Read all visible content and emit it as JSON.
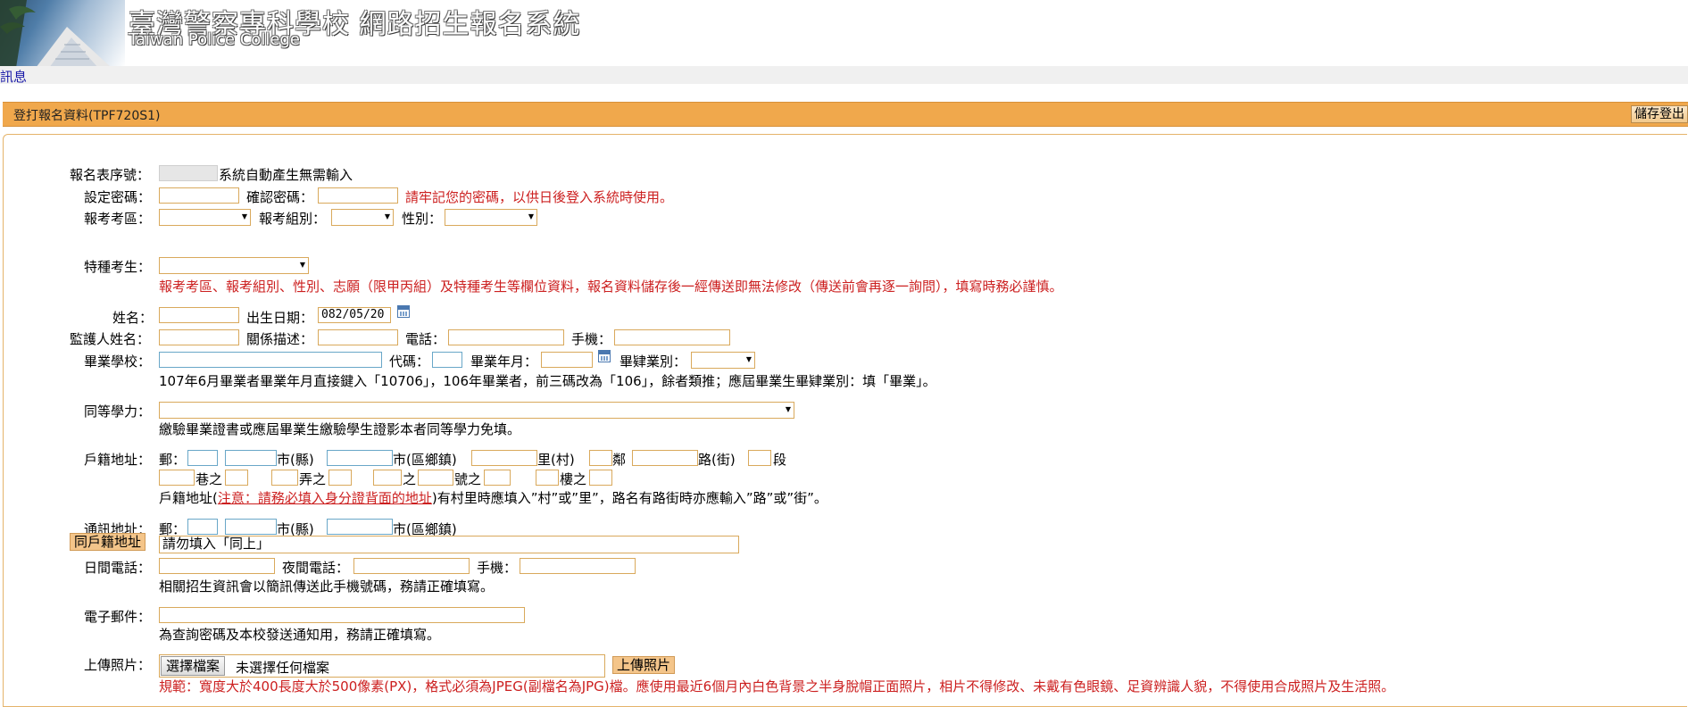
{
  "header": {
    "title": "臺灣警察專科學校  網路招生報名系統",
    "subtitle": "Taiwan Police College"
  },
  "messages_link": "訊息",
  "section": {
    "title": "登打報名資料(TPF720S1)",
    "save_logout": "儲存登出"
  },
  "form": {
    "serial_label": "報名表序號：",
    "serial_note": "系統自動產生無需輸入",
    "pwd_label": "設定密碼：",
    "pwd_confirm_label": "確認密碼：",
    "pwd_note": "請牢記您的密碼，以供日後登入系統時使用。",
    "region_label": "報考考區：",
    "group_label": "報考組別：",
    "gender_label": "性別：",
    "special_label": "特種考生：",
    "special_note": "報考考區、報考組別、性別、志願（限甲丙組）及特種考生等欄位資料，報名資料儲存後一經傳送即無法修改（傳送前會再逐一詢問），填寫時務必謹慎。",
    "name_label": "姓名：",
    "birth_label": "出生日期：",
    "birth_value": "082/05/20",
    "guardian_label": "監護人姓名：",
    "relation_label": "關係描述：",
    "phone_label": "電話：",
    "mobile_label": "手機：",
    "school_label": "畢業學校：",
    "code_label": "代碼：",
    "grad_ym_label": "畢業年月：",
    "grad_type_label": "畢肄業別：",
    "grad_note": "107年6月畢業者畢業年月直接鍵入「10706」，106年畢業者，前三碼改為「106」，餘者類推；應屆畢業生畢肄業別：填「畢業」。",
    "equiv_label": "同等學力：",
    "equiv_note": "繳驗畢業證書或應屆畢業生繳驗學生證影本者同等學力免填。",
    "household_label": "戶籍地址：",
    "zip_label": "郵：",
    "city_label": "市(縣)",
    "district_label": "市(區鄉鎮)",
    "village_label": "里(村)",
    "neighbor_label": "鄰",
    "road_label": "路(街)",
    "section_label": "段",
    "lane_label": "巷之",
    "alley_label": "弄之",
    "zhi_label": "之",
    "number_label": "號之",
    "floor_label": "樓之",
    "household_note_a": "戶籍地址(",
    "household_note_link": "注意：請務必填入身分證背面的地址",
    "household_note_b": ")有村里時應填入”村”或”里”，路名有路街時亦應輸入”路”或”街”。",
    "mail_label": "通訊地址：",
    "same_btn": "同戶籍地址",
    "mail_placeholder": "請勿填入「同上」",
    "day_phone_label": "日間電話：",
    "night_phone_label": "夜間電話：",
    "mobile2_label": "手機：",
    "phone_note": "相關招生資訊會以簡訊傳送此手機號碼，務請正確填寫。",
    "email_label": "電子郵件：",
    "email_note": "為查詢密碼及本校發送通知用，務請正確填寫。",
    "photo_label": "上傳照片：",
    "choose_file": "選擇檔案",
    "no_file": "未選擇任何檔案",
    "upload_btn": "上傳照片",
    "photo_note": "規範：寬度大於400長度大於500像素(PX)，格式必須為JPEG(副檔名為JPG)檔。應使用最近6個月內白色背景之半身脫帽正面照片，相片不得修改、未戴有色眼鏡、足資辨識人貌，不得使用合成照片及生活照。"
  }
}
